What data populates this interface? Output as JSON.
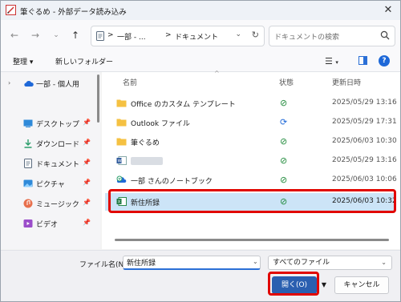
{
  "window": {
    "title": "筆ぐるめ - 外部データ読み込み"
  },
  "nav": {
    "back_icon": "arrow-left-icon",
    "forward_icon": "arrow-right-icon",
    "recent_icon": "chevron-down-icon",
    "up_icon": "arrow-up-icon"
  },
  "address": {
    "segments": [
      "一部 - ...",
      "ドキュメント"
    ],
    "separator": ">"
  },
  "search": {
    "placeholder": "ドキュメントの検索"
  },
  "toolbar": {
    "organize_label": "整理",
    "new_folder_label": "新しいフォルダー"
  },
  "sidebar": {
    "items": [
      {
        "label": "一部 - 個人用",
        "icon": "cloud-icon",
        "pinned": false,
        "expandable": true
      },
      {
        "label": "デスクトップ",
        "icon": "desktop-icon",
        "pinned": true
      },
      {
        "label": "ダウンロード",
        "icon": "download-icon",
        "pinned": true
      },
      {
        "label": "ドキュメント",
        "icon": "document-icon",
        "pinned": true
      },
      {
        "label": "ピクチャ",
        "icon": "picture-icon",
        "pinned": true
      },
      {
        "label": "ミュージック",
        "icon": "music-icon",
        "pinned": true
      },
      {
        "label": "ビデオ",
        "icon": "video-icon",
        "pinned": true
      }
    ]
  },
  "list": {
    "columns": {
      "name": "名前",
      "status": "状態",
      "date": "更新日時"
    },
    "rows": [
      {
        "name": "Office のカスタム テンプレート",
        "icon": "folder-icon",
        "status": "synced",
        "date": "2025/05/29 13:16"
      },
      {
        "name": "Outlook ファイル",
        "icon": "folder-icon",
        "status": "syncing",
        "date": "2025/05/29 17:31"
      },
      {
        "name": "筆ぐるめ",
        "icon": "folder-icon",
        "status": "synced",
        "date": "2025/06/03 10:30"
      },
      {
        "name": "",
        "icon": "word-file-icon",
        "status": "synced",
        "date": "2025/05/29 13:16"
      },
      {
        "name": "一部 さんのノートブック",
        "icon": "notebook-icon",
        "status": "synced",
        "date": "2025/06/03 10:06"
      },
      {
        "name": "新住所録",
        "icon": "excel-file-icon",
        "status": "synced",
        "date": "2025/06/03 10:32",
        "selected": true
      }
    ]
  },
  "footer": {
    "filename_label": "ファイル名(N):",
    "filename_value": "新住所録",
    "filetype_value": "すべてのファイル",
    "open_label": "開く(O)",
    "cancel_label": "キャンセル"
  },
  "colors": {
    "accent": "#2a5fb0",
    "highlight": "#e10600",
    "selection": "#cce4f7"
  }
}
